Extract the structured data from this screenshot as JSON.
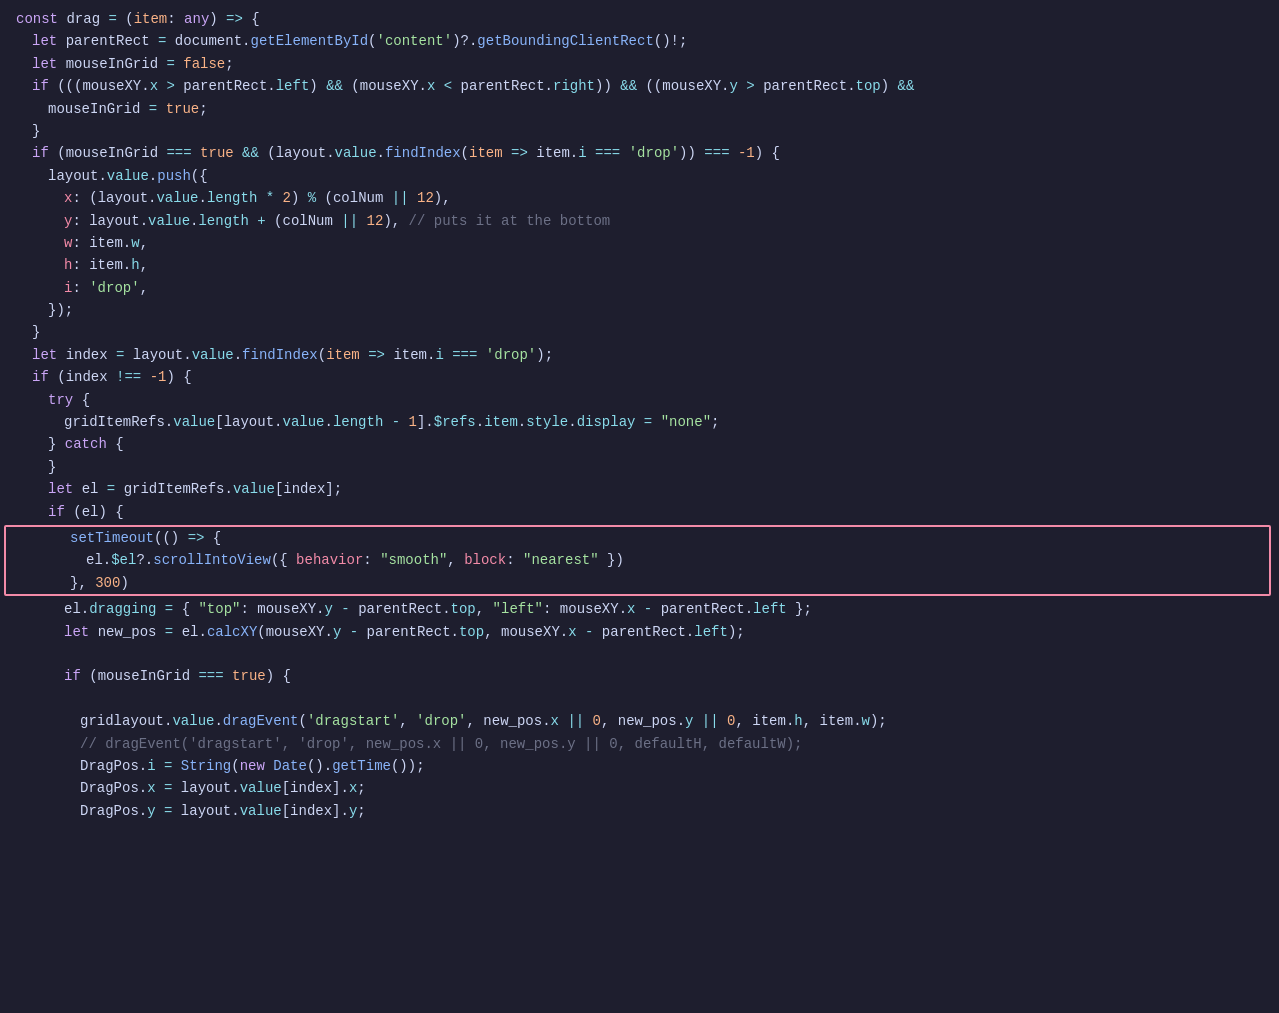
{
  "colors": {
    "bg": "#1e1e2e",
    "keyword": "#cba6f7",
    "function": "#89b4fa",
    "string": "#a6e3a1",
    "number": "#fab387",
    "operator": "#89dceb",
    "comment": "#6c7086",
    "text": "#cdd6f4",
    "error": "#f38ba8"
  },
  "highlight_box": {
    "visible": true,
    "border_color": "#f38ba8"
  }
}
